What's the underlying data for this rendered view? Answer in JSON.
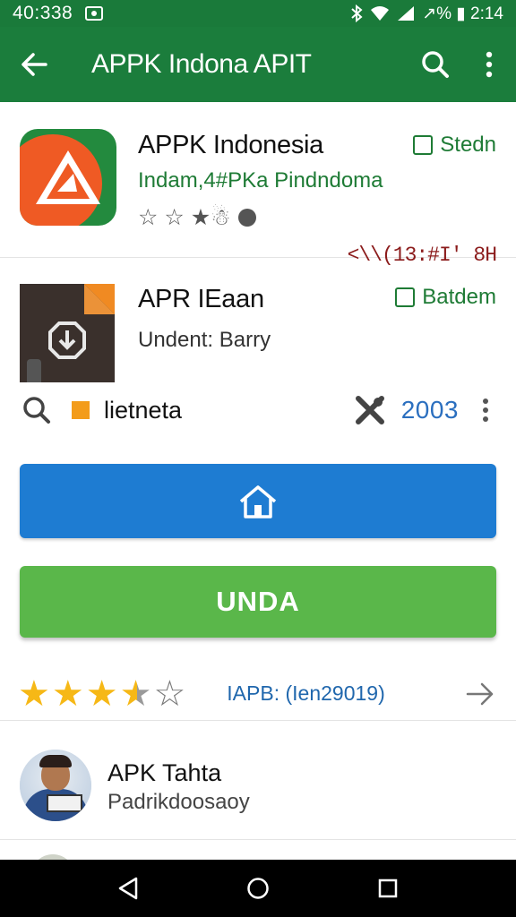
{
  "status_bar": {
    "time": "40:338",
    "right_text": "↗% ▮ 2:14",
    "icons": [
      "photo-icon",
      "bluetooth-icon",
      "wifi-icon",
      "signal-icon",
      "battery-icon"
    ]
  },
  "app_bar": {
    "title": "APPK Indona APIT",
    "icons": [
      "back-arrow-icon",
      "search-icon",
      "more-vert-icon"
    ]
  },
  "listings": [
    {
      "name": "APPK Indonesia",
      "developer": "Indam,4#PKa Pindndoma",
      "badge": "Stedn",
      "rating_text": "☆ ☆ ★☃",
      "overflow_label": "<\\\\(13:#I' 8H"
    },
    {
      "name": "APR IEaan",
      "developer": "Undent: Barry",
      "badge": "Batdem"
    }
  ],
  "tool_row": {
    "label": "lietneta",
    "number": "2003"
  },
  "buttons": {
    "install_label": "UNDA"
  },
  "rating": {
    "stars": 3.5,
    "count_label": "IAPB: (Ien29019)"
  },
  "review": {
    "name": "APK Tahta",
    "subtitle": "Padrikdoosaoy"
  },
  "colors": {
    "app_bar": "#1b7d3c",
    "home_button": "#1e7cd2",
    "install_button": "#5ab74a",
    "star": "#f6b816",
    "link": "#2067ad"
  }
}
